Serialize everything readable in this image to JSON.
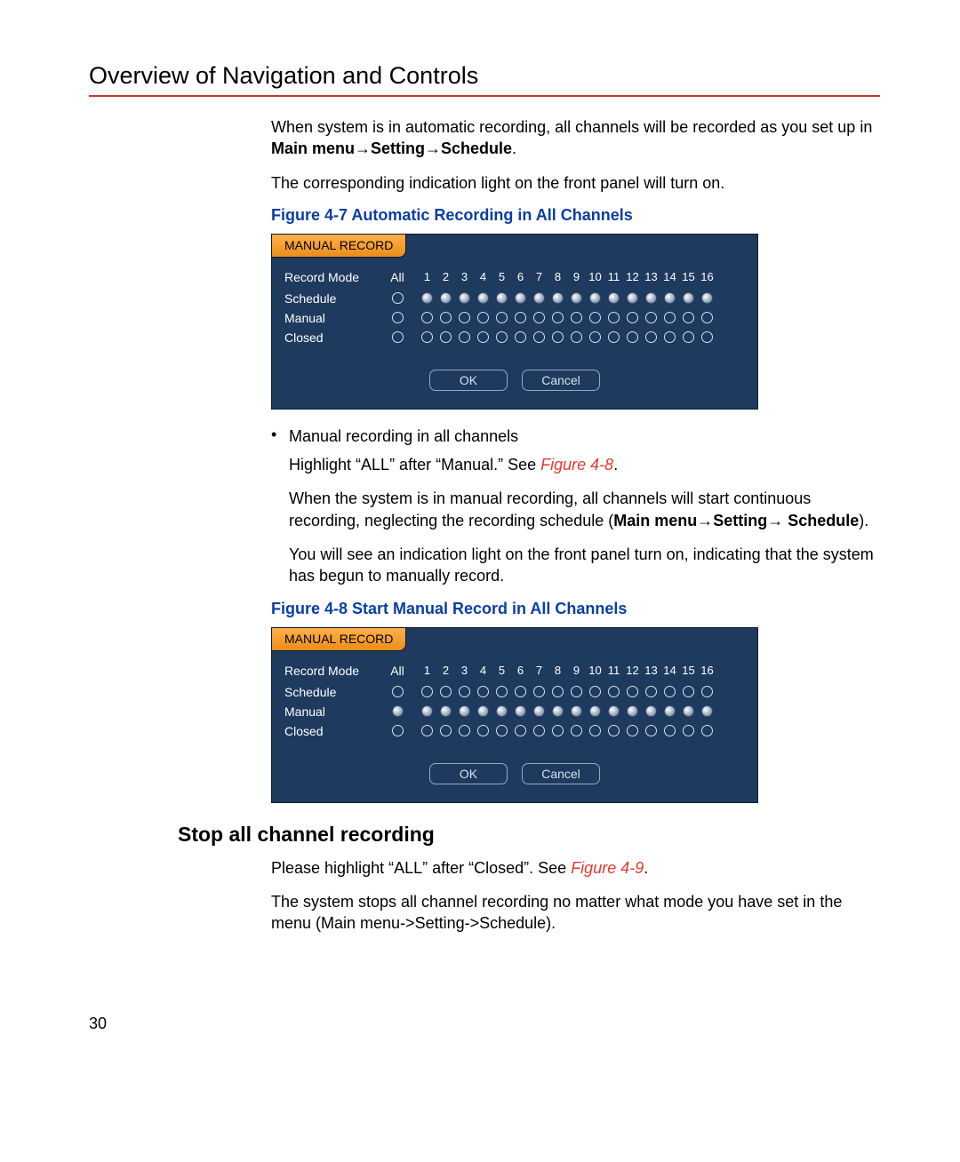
{
  "title": "Overview of Navigation and Controls",
  "para1_a": "When system is in automatic recording, all channels will be recorded as you set up in ",
  "para1_b": "Main menu→Setting→Schedule",
  "para2": "The corresponding indication light on the front panel will turn on.",
  "fig47_caption": "Figure 4-7 Automatic Recording in All Channels",
  "panel": {
    "tab": "MANUAL RECORD",
    "record_mode": "Record Mode",
    "all_label": "All",
    "row_schedule": "Schedule",
    "row_manual": "Manual",
    "row_closed": "Closed",
    "ok": "OK",
    "cancel": "Cancel",
    "channels": [
      "1",
      "2",
      "3",
      "4",
      "5",
      "6",
      "7",
      "8",
      "9",
      "10",
      "11",
      "12",
      "13",
      "14",
      "15",
      "16"
    ]
  },
  "fig47_state": {
    "schedule_all": false,
    "schedule_sel": true,
    "manual_all": false,
    "manual_sel": false,
    "closed_all": false,
    "closed_sel": false
  },
  "bullet_manual": "Manual recording in all channels",
  "para3_a": "Highlight “ALL” after “Manual.” See ",
  "para3_ref": "Figure 4-8",
  "para4_a": "When the system is in manual recording, all channels will start continuous recording, neglecting the recording schedule (",
  "para4_b": "Main menu→Setting→ Schedule",
  "para4_c": ").",
  "para5": "You will see an indication light on the front panel turn on, indicating that the system has begun to manually record.",
  "fig48_caption": "Figure 4-8 Start Manual Record in All Channels",
  "fig48_state": {
    "schedule_all": false,
    "schedule_sel": false,
    "manual_all": true,
    "manual_sel": true,
    "closed_all": false,
    "closed_sel": false
  },
  "h2_stop": "Stop all channel recording",
  "para6_a": "Please highlight “ALL” after “Closed”. See ",
  "para6_ref": "Figure 4-9",
  "para7": "The system stops all channel recording no matter what mode you have set in the menu (Main menu->Setting->Schedule).",
  "page_num": "30"
}
